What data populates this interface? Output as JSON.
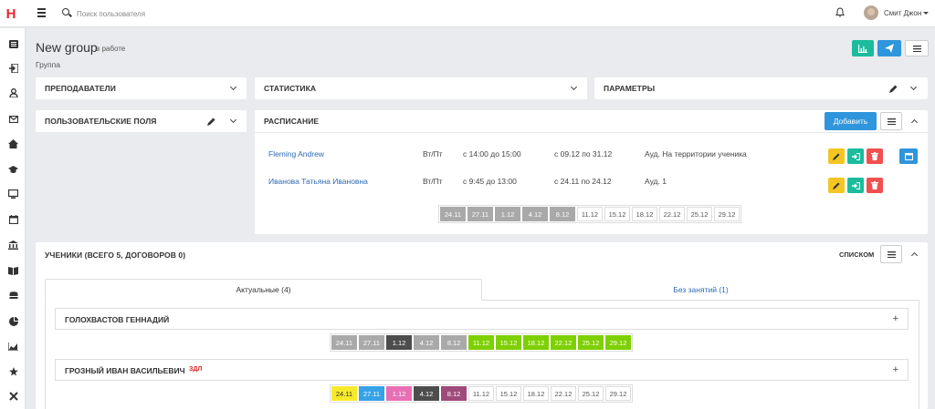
{
  "app": {
    "logo": "H"
  },
  "search": {
    "placeholder": "Поиск пользователя"
  },
  "user": {
    "name": "Смит Джон"
  },
  "page": {
    "title": "New group",
    "status": "в работе",
    "subtitle": "Группа"
  },
  "panels": {
    "teachers": "Преподаватели",
    "stats": "Статистика",
    "params": "Параметры",
    "custom_fields": "Пользовательские поля",
    "schedule": "Расписание",
    "students": "Ученики (всего 5, договоров 0)"
  },
  "schedule": {
    "add_label": "Добавить",
    "rows": [
      {
        "teacher": "Fleming Andrew",
        "days": "Вт/Пт",
        "time": "с 14:00 до 15:00",
        "period": "с 09.12 по 31.12",
        "room": "Ауд. На территории ученика"
      },
      {
        "teacher": "Иванова Татьяна Ивановна",
        "days": "Вт/Пт",
        "time": "с 9:45 до 13:00",
        "period": "с 24.11 по 24.12",
        "room": "Ауд. 1"
      }
    ],
    "dates": [
      "24.11",
      "27.11",
      "1.12",
      "4.12",
      "8.12",
      "11.12",
      "15.12",
      "18.12",
      "22.12",
      "25.12",
      "29.12"
    ],
    "date_styles": [
      "gray",
      "gray",
      "gray",
      "gray",
      "gray",
      "",
      "",
      "",
      "",
      "",
      ""
    ]
  },
  "students": {
    "view_label": "списком",
    "tabs": [
      "Актуальные (4)",
      "Без занятий (1)"
    ],
    "list": [
      {
        "name": "Голохвастов Геннадий",
        "tag": "",
        "dates": [
          "24.11",
          "27.11",
          "1.12",
          "4.12",
          "8.12",
          "11.12",
          "15.12",
          "18.12",
          "22.12",
          "25.12",
          "29.12"
        ],
        "styles": [
          "gray",
          "gray",
          "dark",
          "gray",
          "gray",
          "green",
          "green",
          "green",
          "green",
          "green",
          "green"
        ]
      },
      {
        "name": "Грозный Иван Васильевич",
        "tag": "ЗДЛ",
        "dates": [
          "24.11",
          "27.11",
          "1.12",
          "4.12",
          "8.12",
          "11.12",
          "15.12",
          "18.12",
          "22.12",
          "25.12",
          "29.12"
        ],
        "styles": [
          "yellow",
          "blue",
          "pink",
          "dark",
          "plum",
          "",
          "",
          "",
          "",
          "",
          ""
        ]
      }
    ],
    "plus_label": "+"
  },
  "colors": {
    "teal": "#1abc9c",
    "blue": "#2f95dc",
    "yellow": "#f3c623",
    "red": "#f05050",
    "accent_red": "#e8262c"
  },
  "icons": [
    "search-icon",
    "bell-icon",
    "chart-icon",
    "send-icon",
    "menu-icon",
    "pencil-icon",
    "sign-in-icon",
    "trash-icon",
    "calendar-icon",
    "chevron-down-icon",
    "chevron-up-icon"
  ]
}
